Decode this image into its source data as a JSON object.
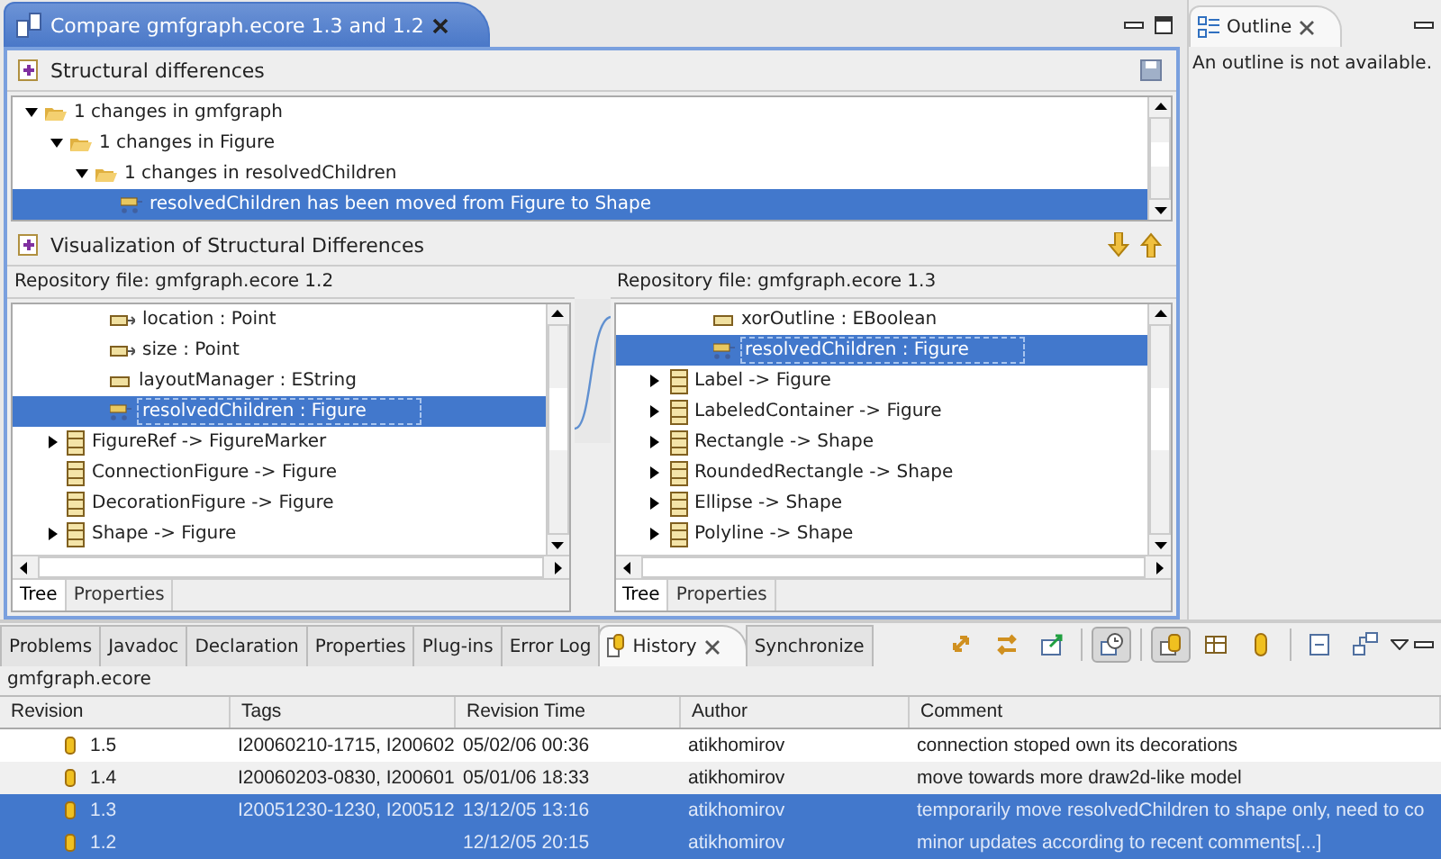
{
  "editor": {
    "tab": {
      "title": "Compare gmfgraph.ecore 1.3 and 1.2",
      "selected": true
    },
    "structural": {
      "title": "Structural differences",
      "tree": [
        {
          "label": "1 changes in gmfgraph",
          "kind": "group",
          "expanded": true,
          "selected": false,
          "children": [
            {
              "label": "1 changes in Figure",
              "kind": "group",
              "expanded": true,
              "selected": false,
              "children": [
                {
                  "label": "1 changes in resolvedChildren",
                  "kind": "group",
                  "expanded": true,
                  "selected": false,
                  "children": [
                    {
                      "label": "resolvedChildren has been moved from Figure to Shape",
                      "kind": "move",
                      "selected": true
                    }
                  ]
                }
              ]
            }
          ]
        }
      ]
    },
    "visualization": {
      "title": "Visualization of Structural Differences",
      "panes": [
        {
          "repository": "Repository file: gmfgraph.ecore 1.2",
          "items": [
            {
              "label": "location : Point",
              "kind": "reference",
              "expandable": false,
              "selected": false
            },
            {
              "label": "size : Point",
              "kind": "reference",
              "expandable": false,
              "selected": false
            },
            {
              "label": "layoutManager : EString",
              "kind": "attribute",
              "expandable": false,
              "selected": false
            },
            {
              "label": "resolvedChildren : Figure",
              "kind": "moved",
              "expandable": false,
              "selected": true
            },
            {
              "label": "FigureRef -> FigureMarker",
              "kind": "class",
              "expandable": true,
              "selected": false
            },
            {
              "label": "ConnectionFigure -> Figure",
              "kind": "class",
              "expandable": false,
              "selected": false
            },
            {
              "label": "DecorationFigure -> Figure",
              "kind": "class",
              "expandable": false,
              "selected": false
            },
            {
              "label": "Shape -> Figure",
              "kind": "class",
              "expandable": true,
              "selected": false
            }
          ],
          "tabs": [
            {
              "label": "Tree",
              "selected": true
            },
            {
              "label": "Properties",
              "selected": false
            }
          ]
        },
        {
          "repository": "Repository file: gmfgraph.ecore 1.3",
          "items": [
            {
              "label": "xorOutline : EBoolean",
              "kind": "attribute",
              "expandable": false,
              "selected": false
            },
            {
              "label": "resolvedChildren : Figure",
              "kind": "moved",
              "expandable": false,
              "selected": true
            },
            {
              "label": "Label -> Figure",
              "kind": "class",
              "expandable": true,
              "selected": false
            },
            {
              "label": "LabeledContainer -> Figure",
              "kind": "class",
              "expandable": true,
              "selected": false
            },
            {
              "label": "Rectangle -> Shape",
              "kind": "class",
              "expandable": true,
              "selected": false
            },
            {
              "label": "RoundedRectangle -> Shape",
              "kind": "class",
              "expandable": true,
              "selected": false
            },
            {
              "label": "Ellipse -> Shape",
              "kind": "class",
              "expandable": true,
              "selected": false
            },
            {
              "label": "Polyline -> Shape",
              "kind": "class",
              "expandable": true,
              "selected": false
            }
          ],
          "tabs": [
            {
              "label": "Tree",
              "selected": true
            },
            {
              "label": "Properties",
              "selected": false
            }
          ]
        }
      ]
    }
  },
  "outline": {
    "tab": {
      "title": "Outline",
      "selected": true
    },
    "message": "An outline is not available."
  },
  "bottom": {
    "tabs": [
      {
        "label": "Problems",
        "selected": false
      },
      {
        "label": "Javadoc",
        "selected": false
      },
      {
        "label": "Declaration",
        "selected": false
      },
      {
        "label": "Properties",
        "selected": false
      },
      {
        "label": "Plug-ins",
        "selected": false
      },
      {
        "label": "Error Log",
        "selected": false
      },
      {
        "label": "History",
        "selected": true
      },
      {
        "label": "Synchronize",
        "selected": false
      }
    ],
    "toolbar": [
      {
        "kind": "compare",
        "pressed": false
      },
      {
        "kind": "swap",
        "pressed": false
      },
      {
        "kind": "export",
        "pressed": false
      },
      {
        "kind": "history",
        "pressed": true
      },
      {
        "kind": "local",
        "pressed": true
      },
      {
        "kind": "table",
        "pressed": false
      },
      {
        "kind": "remote",
        "pressed": false
      },
      {
        "kind": "collapse",
        "pressed": false
      },
      {
        "kind": "link",
        "pressed": false
      }
    ],
    "file": "gmfgraph.ecore",
    "table": {
      "columns": [
        "Revision",
        "Tags",
        "Revision Time",
        "Author",
        "Comment"
      ],
      "rows": [
        {
          "cells": [
            "1.5",
            "I20060210-1715, I200602",
            "05/02/06 00:36",
            "atikhomirov",
            "connection stoped own its decorations"
          ],
          "selected": false
        },
        {
          "cells": [
            "1.4",
            "I20060203-0830, I200601",
            "05/01/06 18:33",
            "atikhomirov",
            "move towards more draw2d-like model"
          ],
          "selected": false
        },
        {
          "cells": [
            "1.3",
            "I20051230-1230, I200512",
            "13/12/05 13:16",
            "atikhomirov",
            "temporarily move resolvedChildren to shape only, need to co"
          ],
          "selected": true
        },
        {
          "cells": [
            "1.2",
            "",
            "12/12/05 20:15",
            "atikhomirov",
            "minor updates according to recent comments[...]"
          ],
          "selected": true
        }
      ]
    }
  }
}
